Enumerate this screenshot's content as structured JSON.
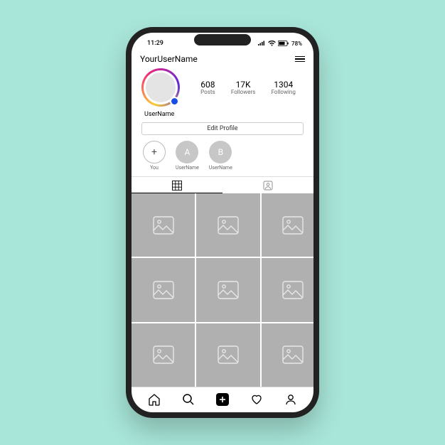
{
  "status": {
    "time": "11:29",
    "battery": "78%"
  },
  "header": {
    "username": "YourUserName"
  },
  "profile": {
    "display_name": "UserName",
    "stats": {
      "posts": {
        "value": "608",
        "label": "Posts"
      },
      "followers": {
        "value": "17K",
        "label": "Followers"
      },
      "following": {
        "value": "1304",
        "label": "Following"
      }
    },
    "edit_label": "Edit Profile"
  },
  "highlights": {
    "add": {
      "glyph": "+",
      "label": "You"
    },
    "items": [
      {
        "glyph": "A",
        "label": "UserName"
      },
      {
        "glyph": "B",
        "label": "UserName"
      }
    ]
  }
}
